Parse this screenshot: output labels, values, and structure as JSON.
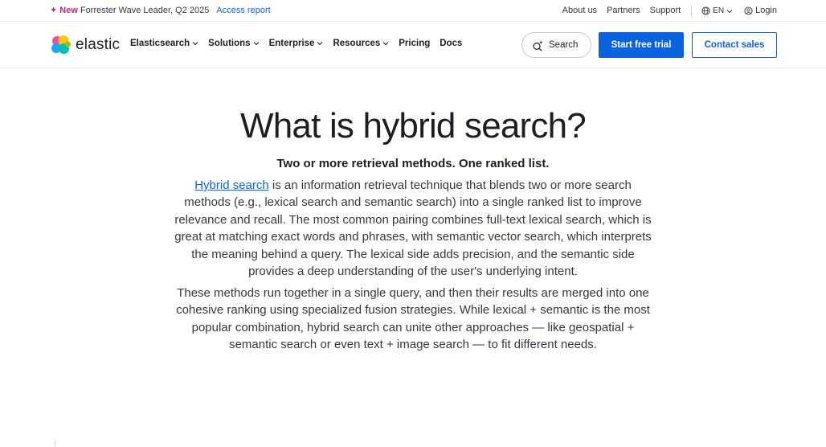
{
  "topbar": {
    "new_label": "✦ New",
    "announcement": "Forrester Wave Leader, Q2 2025",
    "announcement_link": "Access report",
    "about": "About us",
    "partners": "Partners",
    "support": "Support",
    "language": "EN",
    "login": "Login"
  },
  "nav": {
    "brand": "elastic",
    "items": [
      {
        "label": "Elasticsearch",
        "has_dropdown": true
      },
      {
        "label": "Solutions",
        "has_dropdown": true
      },
      {
        "label": "Enterprise",
        "has_dropdown": true
      },
      {
        "label": "Resources",
        "has_dropdown": true
      },
      {
        "label": "Pricing",
        "has_dropdown": false
      },
      {
        "label": "Docs",
        "has_dropdown": false
      }
    ],
    "search_label": "Search",
    "trial_label": "Start free trial",
    "contact_label": "Contact sales"
  },
  "hero": {
    "title": "What is hybrid search?",
    "subtitle": "Two or more retrieval methods. One ranked list.",
    "p1_link": "Hybrid search",
    "p1_rest": " is an information retrieval technique that blends two or more search methods (e.g., lexical search and semantic search) into a single ranked list to improve relevance and recall. The most common pairing combines full-text lexical search, which is great at matching exact words and phrases, with semantic vector search, which interprets the meaning behind a query. The lexical side adds precision, and the semantic side provides a deep understanding of the user's underlying intent.",
    "p2": "These methods run together in a single query, and then their results are merged into one cohesive ranking using specialized fusion strategies. While lexical + semantic is the most popular combination, hybrid search can unite other approaches — like geospatial + semantic search or even text + image search — to fit different needs."
  },
  "colors": {
    "accent": "#0b64dd",
    "new_badge": "#d0217d",
    "text": "#1c1e23"
  }
}
